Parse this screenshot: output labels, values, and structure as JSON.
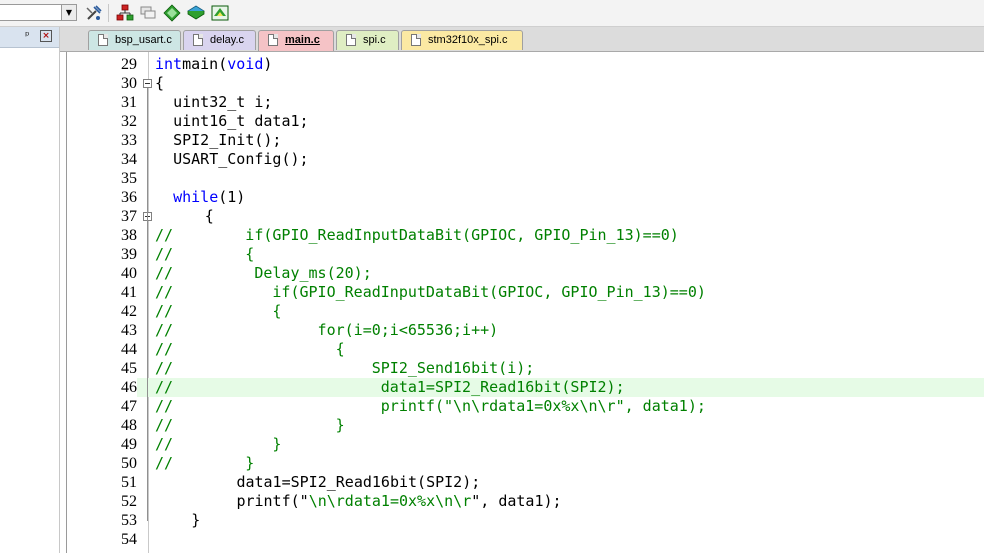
{
  "toolbar": {
    "target_select": {
      "value": ""
    },
    "icons": [
      "options-for-target-icon",
      "manage-project-items-icon",
      "select-packs-icon",
      "pack-installer-icon",
      "manage-run-time-environment-icon",
      "manage-multi-project-icon"
    ]
  },
  "project_panel": {
    "pin_icon": "pin-icon",
    "close_icon": "close-panel-icon"
  },
  "tabs": [
    {
      "label": "bsp_usart.c",
      "color": "#cde6e4"
    },
    {
      "label": "delay.c",
      "color": "#d9d4ef"
    },
    {
      "label": "main.c",
      "color": "#f5c3c6",
      "active": true
    },
    {
      "label": "spi.c",
      "color": "#dfeec3"
    },
    {
      "label": "stm32f10x_spi.c",
      "color": "#fbe9a3"
    }
  ],
  "editor": {
    "highlight_color": "#e6fbe6",
    "lines": [
      {
        "n": "29",
        "ind": 0,
        "t": [
          [
            "kw",
            "int"
          ],
          [
            "",
            "main("
          ],
          [
            "kw",
            "void"
          ],
          [
            "",
            ")"
          ]
        ]
      },
      {
        "n": "30",
        "ind": 0,
        "fold": true,
        "t": [
          [
            "",
            "{"
          ]
        ]
      },
      {
        "n": "31",
        "ind": 2,
        "t": [
          [
            "",
            "uint32_t i;"
          ]
        ]
      },
      {
        "n": "32",
        "ind": 2,
        "t": [
          [
            "",
            "uint16_t data1;"
          ]
        ]
      },
      {
        "n": "33",
        "ind": 2,
        "t": [
          [
            "",
            "SPI2_Init();"
          ]
        ]
      },
      {
        "n": "34",
        "ind": 2,
        "t": [
          [
            "",
            "USART_Config();"
          ]
        ]
      },
      {
        "n": "35",
        "ind": 0,
        "t": []
      },
      {
        "n": "36",
        "ind": 2,
        "t": [
          [
            "kw",
            "while"
          ],
          [
            "",
            "(1)"
          ]
        ]
      },
      {
        "n": "37",
        "ind": 5.5,
        "fold": true,
        "t": [
          [
            "",
            "{"
          ]
        ]
      },
      {
        "n": "38",
        "ind": 0,
        "t": [
          [
            "cm",
            "//        if(GPIO_ReadInputDataBit(GPIOC, GPIO_Pin_13)==0)"
          ]
        ]
      },
      {
        "n": "39",
        "ind": 0,
        "t": [
          [
            "cm",
            "//        {"
          ]
        ]
      },
      {
        "n": "40",
        "ind": 0,
        "t": [
          [
            "cm",
            "//         Delay_ms(20);"
          ]
        ]
      },
      {
        "n": "41",
        "ind": 0,
        "t": [
          [
            "cm",
            "//           if(GPIO_ReadInputDataBit(GPIOC, GPIO_Pin_13)==0)"
          ]
        ]
      },
      {
        "n": "42",
        "ind": 0,
        "t": [
          [
            "cm",
            "//           {"
          ]
        ]
      },
      {
        "n": "43",
        "ind": 0,
        "t": [
          [
            "cm",
            "//                for(i=0;i<65536;i++)"
          ]
        ]
      },
      {
        "n": "44",
        "ind": 0,
        "t": [
          [
            "cm",
            "//                  {"
          ]
        ]
      },
      {
        "n": "45",
        "ind": 0,
        "t": [
          [
            "cm",
            "//                      SPI2_Send16bit(i);"
          ]
        ]
      },
      {
        "n": "46",
        "ind": 0,
        "hl": true,
        "t": [
          [
            "cm",
            "//                       data1=SPI2_Read16bit(SPI2);"
          ]
        ]
      },
      {
        "n": "47",
        "ind": 0,
        "t": [
          [
            "cm",
            "//                       printf(\"\\n\\rdata1=0x%x\\n\\r\", data1);"
          ]
        ]
      },
      {
        "n": "48",
        "ind": 0,
        "t": [
          [
            "cm",
            "//                  }"
          ]
        ]
      },
      {
        "n": "49",
        "ind": 0,
        "t": [
          [
            "cm",
            "//           }"
          ]
        ]
      },
      {
        "n": "50",
        "ind": 0,
        "t": [
          [
            "cm",
            "//        }"
          ]
        ]
      },
      {
        "n": "51",
        "ind": 9,
        "t": [
          [
            "",
            "data1=SPI2_Read16bit(SPI2);"
          ]
        ]
      },
      {
        "n": "52",
        "ind": 9,
        "t": [
          [
            "",
            "printf(\""
          ],
          [
            "cm",
            "\\n\\rdata1=0x%x\\n\\r"
          ],
          [
            "",
            "\", data1);"
          ]
        ]
      },
      {
        "n": "53",
        "ind": 4,
        "t": [
          [
            "",
            "}"
          ]
        ]
      },
      {
        "n": "54",
        "ind": 0,
        "t": []
      }
    ]
  }
}
